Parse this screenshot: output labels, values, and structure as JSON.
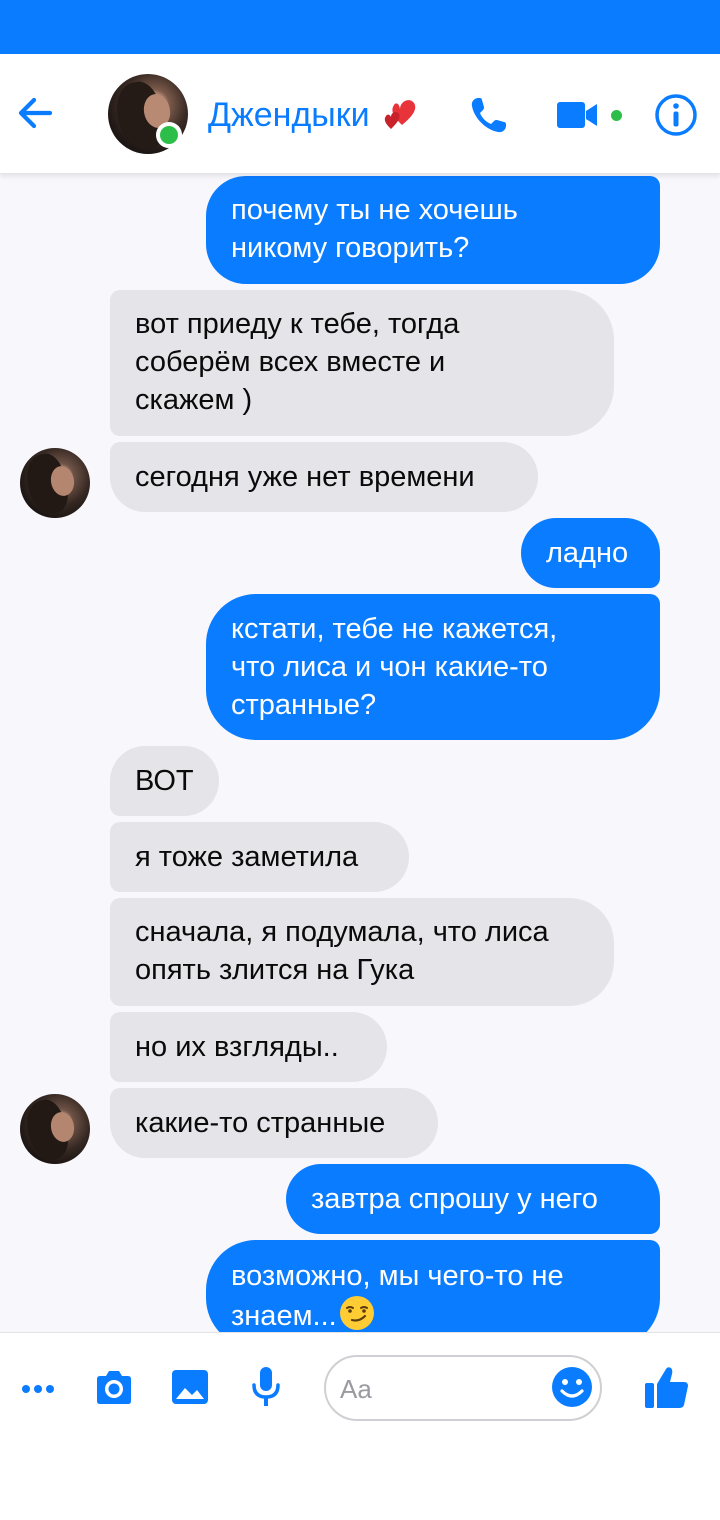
{
  "header": {
    "contact_name": "Дженд­ыки",
    "online": true
  },
  "messages": [
    {
      "side": "out",
      "text": "почему ты не хочешь\nникому говорить?"
    },
    {
      "side": "in",
      "text": "вот приеду к тебе, тогда\nсоберём всех вместе и\nскажем )"
    },
    {
      "side": "in",
      "text": "сегодня уже нет времени",
      "avatar": true
    },
    {
      "side": "out",
      "text": "ладно"
    },
    {
      "side": "out",
      "text": "кстати, тебе не кажется,\nчто лиса и чон какие-то\nстранные?"
    },
    {
      "side": "in",
      "text": "ВОТ"
    },
    {
      "side": "in",
      "text": "я тоже заметила"
    },
    {
      "side": "in",
      "text": "сначала, я подумала, что лиса\nопять злится на Гука"
    },
    {
      "side": "in",
      "text": "но их взгляды.."
    },
    {
      "side": "in",
      "text": "какие-то странные",
      "avatar": true
    },
    {
      "side": "out",
      "text": "завтра спрошу у него"
    },
    {
      "side": "out",
      "text": "возможно, мы чего-то не\nзнаем...",
      "emoji": "smirk"
    }
  ],
  "composer": {
    "placeholder": "Aa"
  },
  "icons": {
    "back": "arrow-left-icon",
    "call": "phone-icon",
    "video": "video-camera-icon",
    "info": "info-icon",
    "more": "more-dots-icon",
    "camera": "camera-icon",
    "gallery": "image-icon",
    "mic": "microphone-icon",
    "emoji": "emoji-icon",
    "like": "thumbs-up-icon"
  },
  "colors": {
    "accent": "#0a7cff",
    "incoming_bubble": "#e4e4e9",
    "online": "#2dbe4a"
  }
}
